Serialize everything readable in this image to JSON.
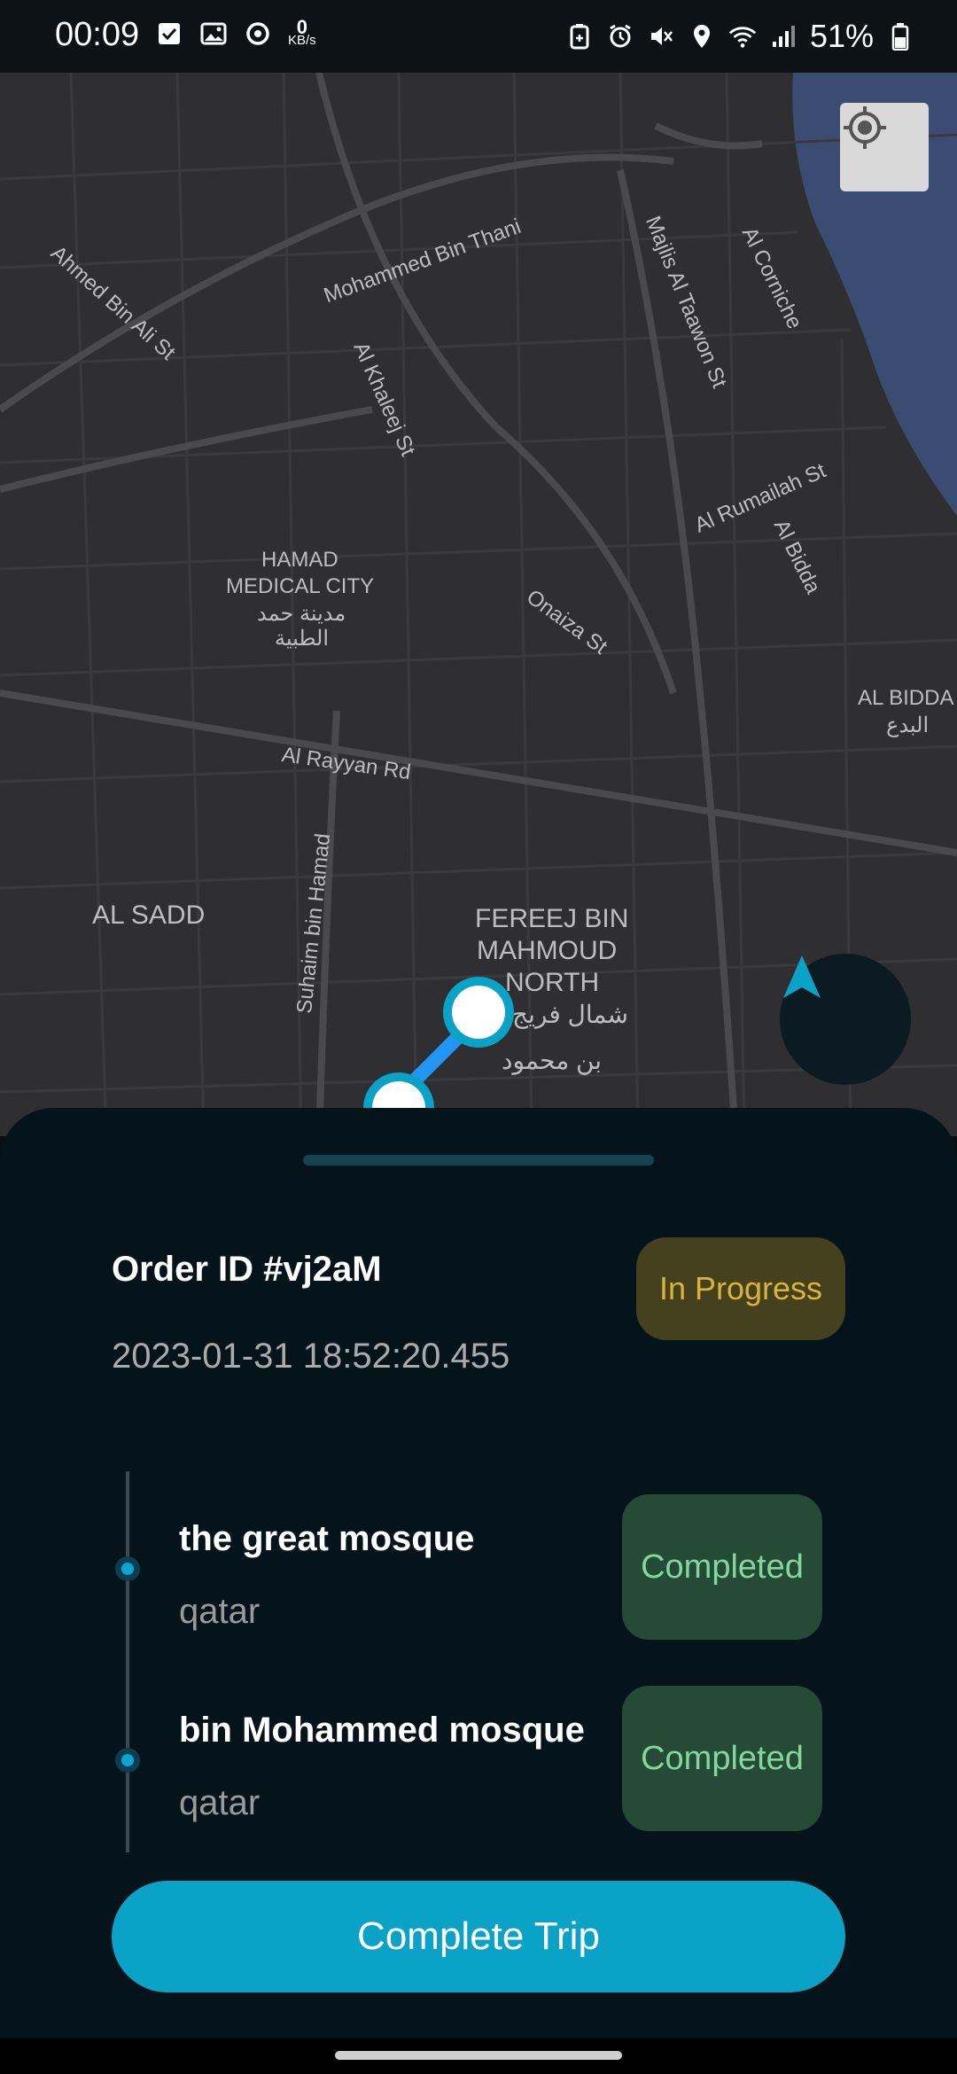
{
  "status_bar": {
    "time": "00:09",
    "net_speed_value": "0",
    "net_speed_unit": "KB/s",
    "battery_percent": "51%"
  },
  "map": {
    "labels": {
      "ahmed_bin_ali": "Ahmed Bin Ali St",
      "mohammed_bin_thani": "Mohammed Bin Thani",
      "majlis": "Majlis Al Taawon St",
      "al_corniche": "Al Corniche",
      "al_khaleej": "Al Khaleej St",
      "al_rumailah": "Al Rumailah St",
      "al_bidda": "Al Bidda",
      "hamad_medical_1": "HAMAD",
      "hamad_medical_2": "MEDICAL CITY",
      "hamad_arabic_1": "مدينة حمد",
      "hamad_arabic_2": "الطبية",
      "onaiza": "Onaiza St",
      "al_bidda_district": "AL BIDDA",
      "al_bidda_arabic": "البدع",
      "al_rayyan": "Al Rayyan Rd",
      "suhaim": "Suhaim bin Hamad",
      "al_sadd": "AL SADD",
      "fereej_1": "FEREEJ BIN",
      "fereej_2": "MAHMOUD",
      "fereej_3": "NORTH",
      "fereej_arabic_1": "شمال فريج",
      "fereej_arabic_2": "بن محمود"
    }
  },
  "order": {
    "id_label": "Order ID #vj2aM",
    "datetime": "2023-01-31 18:52:20.455",
    "status": "In Progress"
  },
  "stops": [
    {
      "name": "the great mosque",
      "country": "qatar",
      "status": "Completed"
    },
    {
      "name": "bin Mohammed mosque",
      "country": "qatar",
      "status": "Completed"
    }
  ],
  "actions": {
    "complete_trip": "Complete Trip"
  },
  "colors": {
    "accent": "#0aa3c7",
    "in_progress_text": "#d9b33a",
    "completed_text": "#82d69e",
    "sheet_bg": "#05141b"
  }
}
